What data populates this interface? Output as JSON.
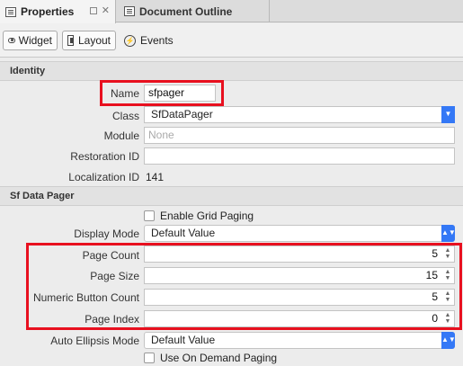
{
  "tabs": [
    {
      "label": "Properties"
    },
    {
      "label": "Document Outline"
    }
  ],
  "toolbar": {
    "widget_label": "Widget",
    "layout_label": "Layout",
    "events_label": "Events"
  },
  "identity": {
    "header": "Identity",
    "name_label": "Name",
    "name_value": "sfpager",
    "class_label": "Class",
    "class_value": "SfDataPager",
    "module_label": "Module",
    "module_placeholder": "None",
    "restoration_label": "Restoration ID",
    "restoration_value": "",
    "localization_label": "Localization ID",
    "localization_value": "141"
  },
  "pager": {
    "header": "Sf Data Pager",
    "enable_grid_paging": "Enable Grid Paging",
    "display_mode_label": "Display Mode",
    "display_mode_value": "Default Value",
    "page_count_label": "Page Count",
    "page_count_value": "5",
    "page_size_label": "Page Size",
    "page_size_value": "15",
    "numeric_button_count_label": "Numeric Button Count",
    "numeric_button_count_value": "5",
    "page_index_label": "Page Index",
    "page_index_value": "0",
    "auto_ellipsis_label": "Auto Ellipsis Mode",
    "auto_ellipsis_value": "Default Value",
    "use_on_demand_paging": "Use On Demand Paging"
  },
  "colors": {
    "highlight": "#e8101f",
    "select_accent": "#3478f6"
  }
}
